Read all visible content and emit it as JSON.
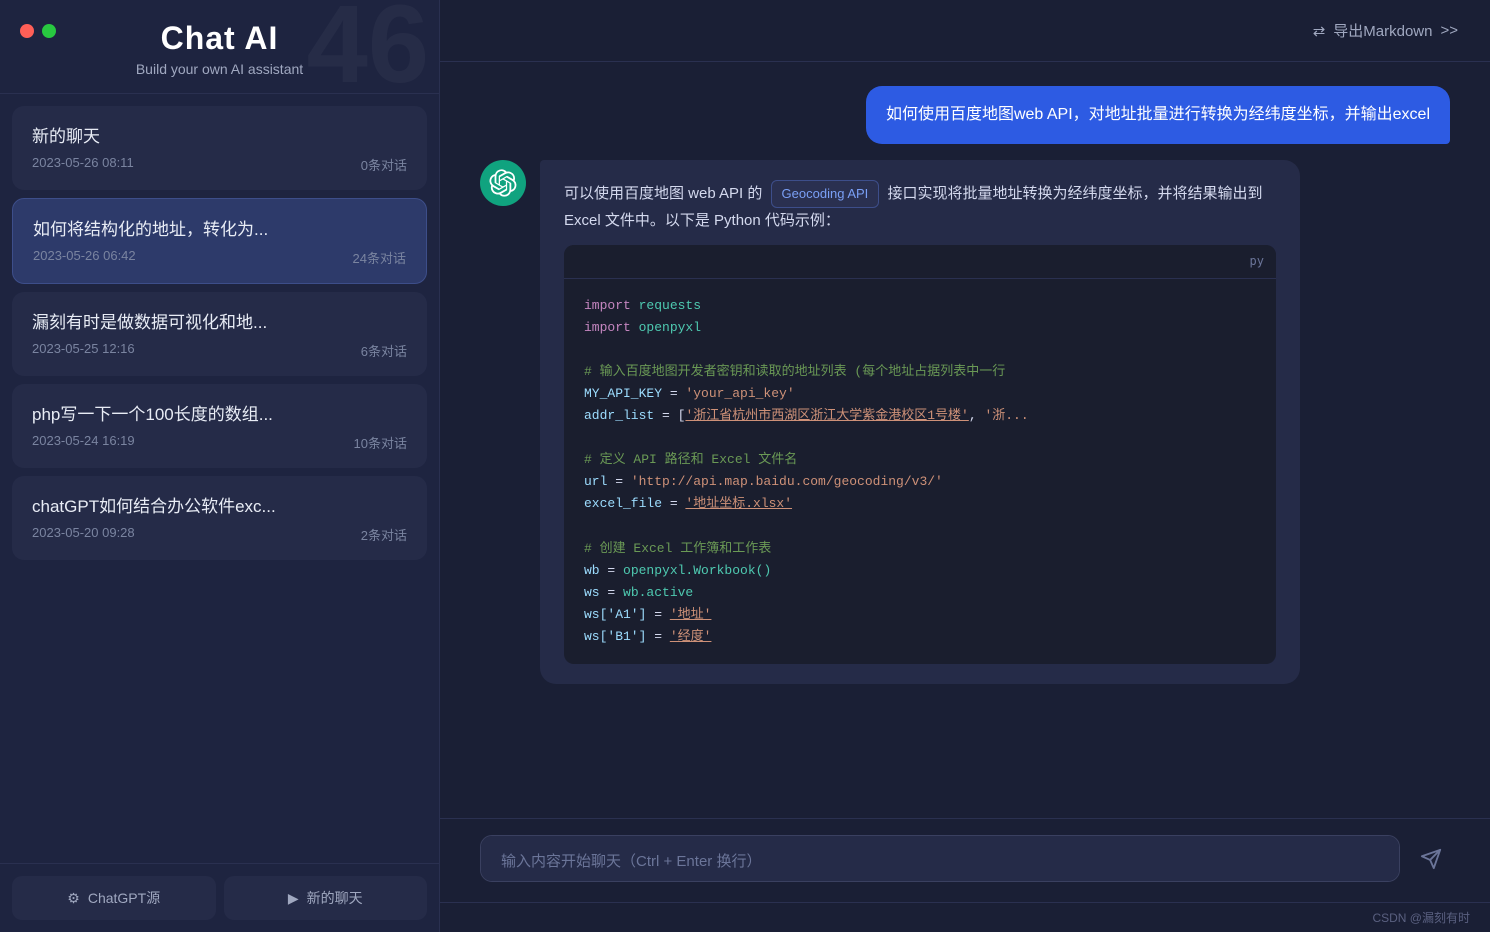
{
  "app": {
    "title": "Chat AI",
    "subtitle": "Build your own AI assistant",
    "watermark": "46"
  },
  "window_controls": {
    "red_label": "close",
    "green_label": "maximize"
  },
  "header": {
    "export_icon": "⇄",
    "export_label": "导出Markdown",
    "export_arrow": ">>"
  },
  "chat_list": {
    "items": [
      {
        "title": "新的聊天",
        "date": "2023-05-26 08:11",
        "count": "0条对话",
        "active": false
      },
      {
        "title": "如何将结构化的地址，转化为...",
        "date": "2023-05-26 06:42",
        "count": "24条对话",
        "active": true
      },
      {
        "title": "漏刻有时是做数据可视化和地...",
        "date": "2023-05-25 12:16",
        "count": "6条对话",
        "active": false
      },
      {
        "title": "php写一下一个100长度的数组...",
        "date": "2023-05-24 16:19",
        "count": "10条对话",
        "active": false
      },
      {
        "title": "chatGPT如何结合办公软件exc...",
        "date": "2023-05-20 09:28",
        "count": "2条对话",
        "active": false
      }
    ]
  },
  "footer": {
    "btn1_icon": "⚙",
    "btn1_label": "ChatGPT源",
    "btn2_icon": "▶",
    "btn2_label": "新的聊天"
  },
  "messages": {
    "user_msg": "如何使用百度地图web API，对地址批量进行转换为经纬度坐标，并输出excel",
    "ai_intro": "可以使用百度地图 web API 的",
    "api_badge": "Geocoding API",
    "ai_intro2": "接口实现将批量地址转换为经纬度坐标，并将结果输出到 Excel 文件中。以下是 Python 代码示例："
  },
  "code": {
    "lang": "py",
    "lines": [
      {
        "type": "import",
        "text": "import requests"
      },
      {
        "type": "import",
        "text": "import openpyxl"
      },
      {
        "type": "blank",
        "text": ""
      },
      {
        "type": "comment",
        "text": "# 输入百度地图开发者密钥和读取的地址列表 (每个地址占据列表中一行"
      },
      {
        "type": "assign",
        "var": "MY_API_KEY",
        "op": " = ",
        "val": "'your_api_key'"
      },
      {
        "type": "assign",
        "var": "addr_list",
        "op": " = [",
        "val": "'浙江省杭州市西湖区浙江大学紫金港校区1号楼'",
        "rest": ", '浙..."
      },
      {
        "type": "blank",
        "text": ""
      },
      {
        "type": "comment",
        "text": "# 定义 API 路径和 Excel 文件名"
      },
      {
        "type": "assign",
        "var": "url",
        "op": " = ",
        "val": "'http://api.map.baidu.com/geocoding/v3/'"
      },
      {
        "type": "assign",
        "var": "excel_file",
        "op": " = ",
        "val": "'地址坐标.xlsx'"
      },
      {
        "type": "blank",
        "text": ""
      },
      {
        "type": "comment",
        "text": "# 创建 Excel 工作簿和工作表"
      },
      {
        "type": "assign",
        "var": "wb",
        "op": " = ",
        "fn": "openpyxl.Workbook()"
      },
      {
        "type": "assign",
        "var": "ws",
        "op": " = ",
        "fn": "wb.active"
      },
      {
        "type": "assign",
        "var": "ws['A1']",
        "op": " = ",
        "val": "'地址'"
      },
      {
        "type": "assign",
        "var": "ws['B1']",
        "op": " = ",
        "val": "'经度'"
      }
    ]
  },
  "input": {
    "placeholder": "输入内容开始聊天（Ctrl + Enter 换行）"
  },
  "page_footer": {
    "text": "CSDN @漏刻有时"
  }
}
